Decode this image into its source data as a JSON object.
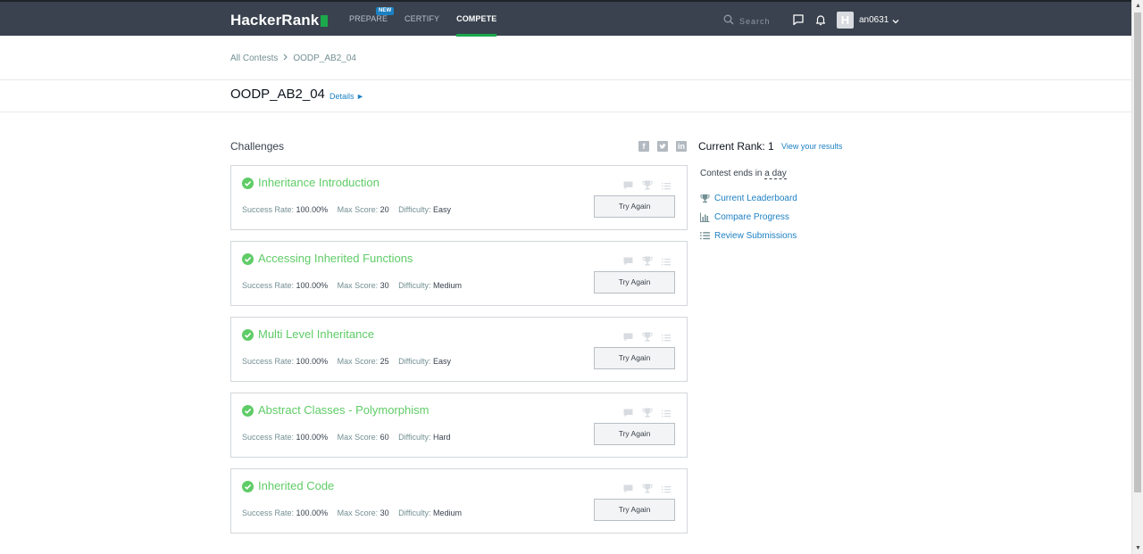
{
  "navbar": {
    "logo": "HackerRank",
    "links": [
      {
        "label": "PREPARE",
        "badge": "NEW"
      },
      {
        "label": "CERTIFY"
      },
      {
        "label": "COMPETE",
        "active": true
      }
    ],
    "search_placeholder": "Search",
    "avatar_letter": "H",
    "username": "an0631"
  },
  "breadcrumb": {
    "root": "All Contests",
    "current": "OODP_AB2_04"
  },
  "contest": {
    "title": "OODP_AB2_04",
    "details_label": "Details ►"
  },
  "challenges": {
    "heading": "Challenges",
    "meta_labels": {
      "success_rate": "Success Rate:",
      "max_score": "Max Score:",
      "difficulty": "Difficulty:"
    },
    "items": [
      {
        "title": "Inheritance Introduction",
        "success_rate": "100.00%",
        "max_score": "20",
        "difficulty": "Easy",
        "button": "Try Again"
      },
      {
        "title": "Accessing Inherited Functions",
        "success_rate": "100.00%",
        "max_score": "30",
        "difficulty": "Medium",
        "button": "Try Again"
      },
      {
        "title": "Multi Level Inheritance",
        "success_rate": "100.00%",
        "max_score": "25",
        "difficulty": "Easy",
        "button": "Try Again"
      },
      {
        "title": "Abstract Classes - Polymorphism",
        "success_rate": "100.00%",
        "max_score": "60",
        "difficulty": "Hard",
        "button": "Try Again"
      },
      {
        "title": "Inherited Code",
        "success_rate": "100.00%",
        "max_score": "30",
        "difficulty": "Medium",
        "button": "Try Again"
      }
    ]
  },
  "sidebar": {
    "current_rank": "Current Rank: 1",
    "view_results": "View your results",
    "contest_ends_prefix": "Contest ends in",
    "contest_ends_duration": "a day",
    "links": [
      {
        "label": "Current Leaderboard",
        "icon": "trophy-icon"
      },
      {
        "label": "Compare Progress",
        "icon": "bar-chart-icon"
      },
      {
        "label": "Review Submissions",
        "icon": "list-icon"
      }
    ]
  },
  "colors": {
    "navbar_bg": "#39424e",
    "accent_green": "#1ba94c",
    "solved_green": "#5fcc67",
    "link_blue": "#1d80c3"
  }
}
